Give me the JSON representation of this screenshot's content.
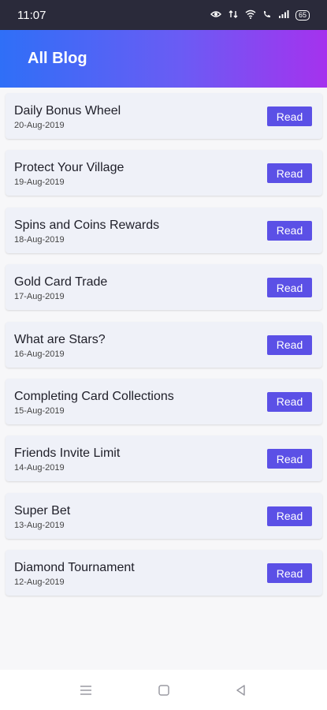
{
  "status_bar": {
    "time": "11:07",
    "battery": "65",
    "icons": [
      "eye-icon",
      "data-icon",
      "wifi-icon",
      "call-icon",
      "signal-icon",
      "battery-icon"
    ]
  },
  "header": {
    "title": "All Blog"
  },
  "blog_items": [
    {
      "title": "Daily Bonus Wheel",
      "date": "20-Aug-2019",
      "button": "Read"
    },
    {
      "title": "Protect Your Village",
      "date": "19-Aug-2019",
      "button": "Read"
    },
    {
      "title": "Spins and Coins Rewards",
      "date": "18-Aug-2019",
      "button": "Read"
    },
    {
      "title": "Gold Card Trade",
      "date": "17-Aug-2019",
      "button": "Read"
    },
    {
      "title": "What are Stars?",
      "date": "16-Aug-2019",
      "button": "Read"
    },
    {
      "title": "Completing Card Collections",
      "date": "15-Aug-2019",
      "button": "Read"
    },
    {
      "title": "Friends Invite Limit",
      "date": "14-Aug-2019",
      "button": "Read"
    },
    {
      "title": "Super Bet",
      "date": "13-Aug-2019",
      "button": "Read"
    },
    {
      "title": "Diamond Tournament",
      "date": "12-Aug-2019",
      "button": "Read"
    }
  ],
  "colors": {
    "accent": "#5b50e6",
    "header_start": "#2f6ff7",
    "header_end": "#a532ee",
    "card_bg": "#eff1f8"
  },
  "nav_bar": {
    "icons": [
      "menu-icon",
      "home-icon",
      "back-icon"
    ]
  }
}
